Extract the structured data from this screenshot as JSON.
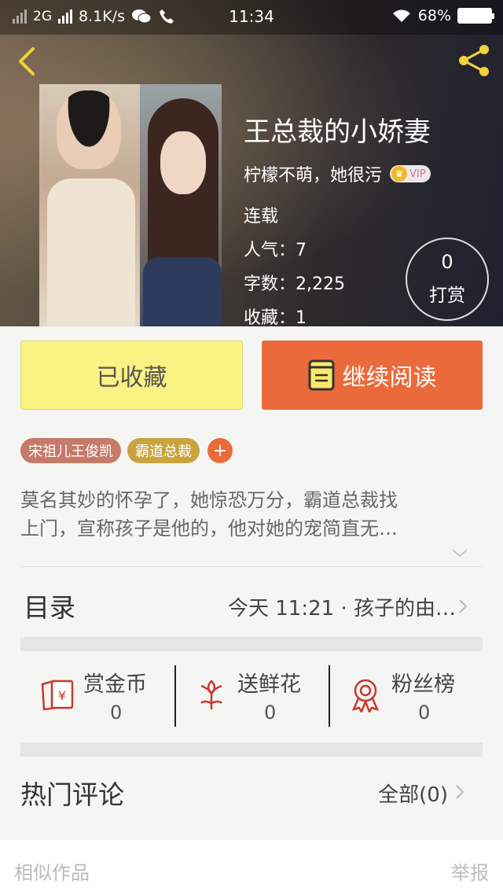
{
  "status_bar": {
    "network": "2G",
    "speed": "8.1K/s",
    "time": "11:34",
    "battery": "68%"
  },
  "book": {
    "title": "王总裁的小娇妻",
    "author": "柠檬不萌，她很污",
    "vip_label": "VIP",
    "status": "连载",
    "popularity": "人气：7",
    "word_count": "字数：2,225",
    "favorites": "收藏：1"
  },
  "reward": {
    "count": "0",
    "label": "打赏"
  },
  "actions": {
    "favorited_label": "已收藏",
    "continue_label": "继续阅读"
  },
  "tags": [
    "宋祖儿王俊凯",
    "霸道总裁"
  ],
  "tag_add": "+",
  "description": {
    "line1": "莫名其妙的怀孕了，她惊恐万分，霸道总裁找",
    "line2": "上门，宣称孩子是他的，他对她的宠简直无…"
  },
  "toc": {
    "title": "目录",
    "latest": "今天 11:21 · 孩子的由…"
  },
  "stats": [
    {
      "label": "赏金币",
      "value": "0",
      "icon": "red-envelope-icon"
    },
    {
      "label": "送鲜花",
      "value": "0",
      "icon": "flower-icon"
    },
    {
      "label": "粉丝榜",
      "value": "0",
      "icon": "medal-icon"
    }
  ],
  "comments": {
    "title": "热门评论",
    "all_label": "全部(0)"
  },
  "footer": {
    "similar": "相似作品",
    "report": "举报"
  },
  "colors": {
    "accent": "#eb6a3b",
    "favorite_bg": "#fbf284",
    "icon_red": "#c8392b"
  }
}
